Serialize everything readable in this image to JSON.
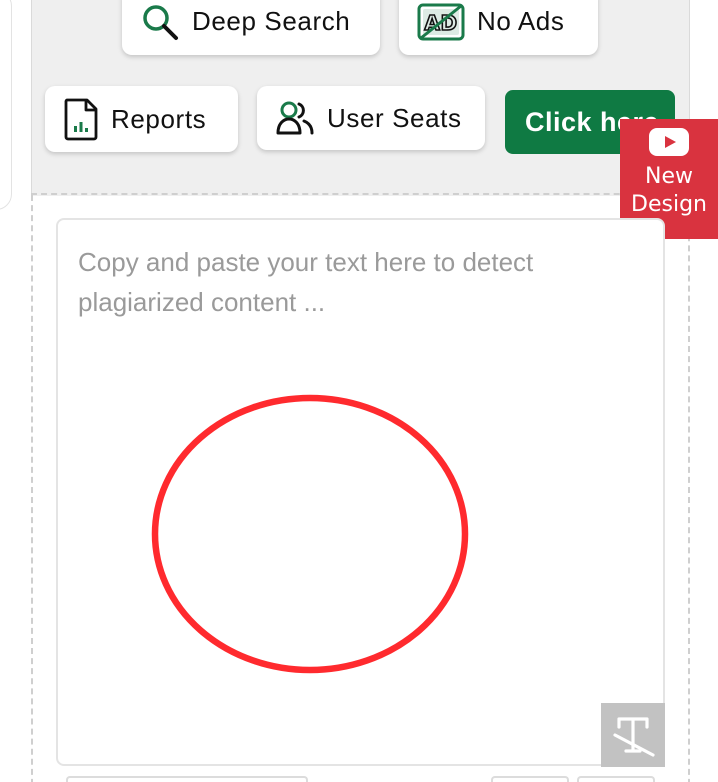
{
  "buttons": {
    "deep_search": {
      "label": "Deep Search",
      "icon": "search-icon"
    },
    "no_ads": {
      "label": "No Ads",
      "icon": "ad-block-icon"
    },
    "reports": {
      "label": "Reports",
      "icon": "report-file-icon"
    },
    "user_seats": {
      "label": "User Seats",
      "icon": "users-icon"
    }
  },
  "cta": {
    "label": "Click here",
    "color": "#0f7a43"
  },
  "video_tab": {
    "line1": "New",
    "line2": "Design",
    "icon": "youtube-icon",
    "color": "#d9333f"
  },
  "editor": {
    "placeholder": "Copy and paste your text here to detect plagiarized content ...",
    "font_toggle_icon": "text-format-icon"
  },
  "annotation": {
    "shape": "circle",
    "color": "#ff2a2e"
  },
  "colors": {
    "accent_green": "#0f7a43",
    "panel_bg": "#efefef"
  }
}
